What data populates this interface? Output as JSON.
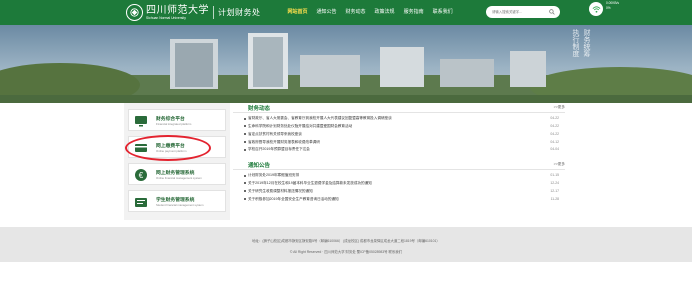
{
  "header": {
    "logo_cn": "四川师范大学",
    "logo_en": "Sichuan Normal University",
    "office_name": "计划财务处",
    "nav": [
      {
        "label": "网站首页",
        "active": true
      },
      {
        "label": "通知公告",
        "active": false
      },
      {
        "label": "财务动态",
        "active": false
      },
      {
        "label": "政策法规",
        "active": false
      },
      {
        "label": "服务指南",
        "active": false
      },
      {
        "label": "联系我们",
        "active": false
      }
    ],
    "search_placeholder": "请输入搜索关键字...",
    "wifi_status_line1": "0.00KB/s",
    "wifi_status_line2": "0%"
  },
  "banner": {
    "vertical_text": [
      "执",
      "行",
      "制",
      "度"
    ],
    "vertical_text2": [
      "财",
      "务",
      "统",
      "筹"
    ]
  },
  "platforms": [
    {
      "title": "财务综合平台",
      "subtitle": "Financial integrated platform",
      "icon": "monitor-icon"
    },
    {
      "title": "网上缴费平台",
      "subtitle": "Online payment platform",
      "icon": "card-icon"
    },
    {
      "title": "网上财务管理系统",
      "subtitle": "Online financial management system",
      "icon": "yuan-icon"
    },
    {
      "title": "学生财务管理系统",
      "subtitle": "Student financial management system",
      "icon": "student-icon"
    }
  ],
  "news": {
    "title": "财务动态",
    "more": ">>更多",
    "items": [
      {
        "text": "省财政厅、省人大常委会、省教育厅到我校开展人大代表建议回复暨高等教育投入调研座谈",
        "date": "04-22"
      },
      {
        "text": "生命科学院和计划财务处赴仪陇开展结对共建暨爱国财会教育活动",
        "date": "04-22"
      },
      {
        "text": "省定点扶贫村有关领导来我校座谈",
        "date": "04-22"
      },
      {
        "text": "省政府督导我校开展财务报表和收费改革调研",
        "date": "04-12"
      },
      {
        "text": "学校召开2019年预算暨目标责任下达会",
        "date": "04-04"
      }
    ]
  },
  "notice": {
    "title": "通知公告",
    "more": ">>更多",
    "items": [
      {
        "text": "计划财务处2019年寒假值班安排",
        "date": "01-15"
      },
      {
        "text": "关于2019年12月在校生和19届本科毕业生退费学金及结算款未发放成功的通知",
        "date": "12-24"
      },
      {
        "text": "关于研究生收费调整材料报送情况的通知",
        "date": "12-17"
      },
      {
        "text": "关于积极参加2019年全国安全生产教育咨询日活动的通知",
        "date": "11-28"
      }
    ]
  },
  "footer": {
    "address_line": "地址：(狮子山校区)成都市静安区静安路5号（邮编610066）        (成龙校区) 成都市龙泉驿区成龙大道二段1819号（邮编610101）",
    "copyright_line": "© All Right Reserved · 四川师范大学 财务处       蜀ICP备05028983号   联系我们"
  },
  "colors": {
    "brand_green": "#1d7a3a",
    "active_nav": "#ffe04d",
    "highlight_red": "#e3232f"
  }
}
